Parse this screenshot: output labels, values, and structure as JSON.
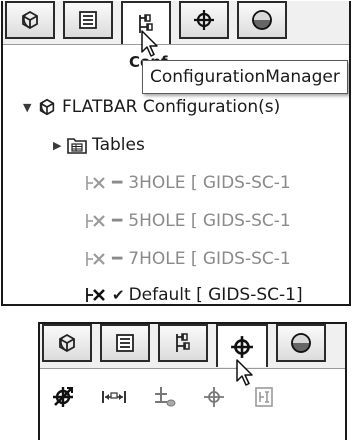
{
  "top_panel": {
    "tabs": [
      {
        "name": "featuremanager",
        "icon": "part-tree-icon"
      },
      {
        "name": "propertymanager",
        "icon": "property-list-icon"
      },
      {
        "name": "configurationmanager",
        "icon": "configuration-icon"
      },
      {
        "name": "dimxpertmanager",
        "icon": "crosshair-icon"
      },
      {
        "name": "display-manager",
        "icon": "appearance-sphere-icon"
      }
    ],
    "active_tab": "configurationmanager",
    "header_label": "Conf",
    "tooltip": "ConfigurationManager",
    "tree": {
      "root_label": "FLATBAR Configuration(s)",
      "root_icon": "part-tree-icon",
      "tables_label": "Tables",
      "tables_icon": "table-folder-icon",
      "configurations": [
        {
          "name": "3HOLE [ GIDS-SC-1",
          "active": false,
          "icon": "configuration-icon"
        },
        {
          "name": "5HOLE [ GIDS-SC-1",
          "active": false,
          "icon": "configuration-icon"
        },
        {
          "name": "7HOLE [ GIDS-SC-1",
          "active": false,
          "icon": "configuration-icon"
        },
        {
          "name": "Default [ GIDS-SC-1]",
          "active": true,
          "icon": "configuration-icon"
        }
      ]
    }
  },
  "bottom_panel": {
    "tabs": [
      {
        "name": "featuremanager",
        "icon": "part-tree-icon"
      },
      {
        "name": "propertymanager",
        "icon": "property-list-icon"
      },
      {
        "name": "configurationmanager",
        "icon": "configuration-icon"
      },
      {
        "name": "dimxpertmanager",
        "icon": "crosshair-icon"
      },
      {
        "name": "display-manager",
        "icon": "appearance-sphere-icon"
      }
    ],
    "active_tab": "dimxpertmanager",
    "tools": [
      {
        "name": "auto-dimension-scheme",
        "icon": "auto-dimension-icon"
      },
      {
        "name": "size-dimension",
        "icon": "size-dimension-icon"
      },
      {
        "name": "location-dimension",
        "icon": "location-dimension-icon"
      },
      {
        "name": "datum",
        "icon": "datum-icon"
      },
      {
        "name": "show-tolerance-status",
        "icon": "tolerance-status-icon"
      }
    ]
  },
  "colors": {
    "border": "#1a1a1a",
    "tab_face": "#dcdcdc",
    "muted_text": "#8a8a8a",
    "tooltip_bg": "#ffffff"
  }
}
